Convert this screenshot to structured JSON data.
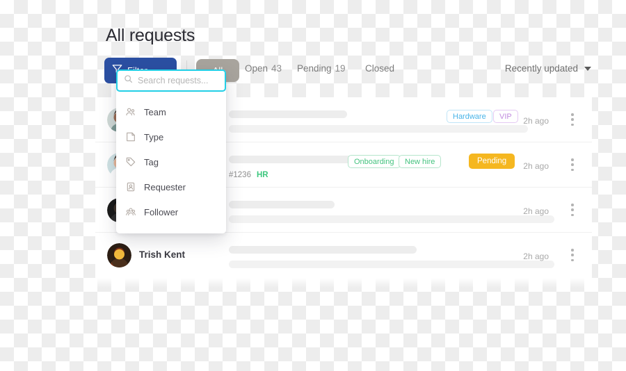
{
  "page": {
    "title": "All requests"
  },
  "toolbar": {
    "filter_button": {
      "label": "Filter",
      "icon": "filter-icon",
      "color": "#2b4fa2"
    },
    "all_pill": {
      "label": "All",
      "color": "#a8a49d"
    },
    "tabs": [
      {
        "label": "Open",
        "count": "43"
      },
      {
        "label": "Pending",
        "count": "19"
      },
      {
        "label": "Closed",
        "count": ""
      }
    ],
    "sort": {
      "label": "Recently updated",
      "icon": "chevron-down-icon"
    }
  },
  "search_popover": {
    "search": {
      "placeholder": "Search requests...",
      "value": "",
      "icon": "search-icon",
      "border_color": "#22cfe6"
    },
    "menu_items": [
      {
        "label": "Team",
        "icon": "team-icon"
      },
      {
        "label": "Type",
        "icon": "type-icon"
      },
      {
        "label": "Tag",
        "icon": "tag-icon"
      },
      {
        "label": "Requester",
        "icon": "requester-icon"
      },
      {
        "label": "Follower",
        "icon": "follower-icon"
      }
    ]
  },
  "requests": [
    {
      "requester": "",
      "ticket_id": "",
      "department": "",
      "chips": [
        {
          "label": "Hardware",
          "style": "chip-blue"
        },
        {
          "label": "VIP",
          "style": "chip-purple"
        }
      ],
      "status": "",
      "time": "2h ago",
      "menu_icon": "kebab-menu-icon",
      "skeleton": {
        "title_width": 170,
        "sub_width": 430
      }
    },
    {
      "requester": "",
      "ticket_id": "#1236",
      "department": "HR",
      "chips": [
        {
          "label": "Onboarding",
          "style": "chip-green"
        },
        {
          "label": "New hire",
          "style": "chip-green"
        }
      ],
      "status": "Pending",
      "time": "2h ago",
      "menu_icon": "kebab-menu-icon",
      "skeleton": {
        "title_width": 290,
        "sub_width": 0
      }
    },
    {
      "requester": "",
      "ticket_id": "",
      "department": "",
      "chips": [],
      "status": "",
      "time": "2h ago",
      "menu_icon": "kebab-menu-icon",
      "skeleton": {
        "title_width": 152,
        "sub_width": 468
      }
    },
    {
      "requester": "Trish Kent",
      "ticket_id": "",
      "department": "",
      "chips": [],
      "status": "",
      "time": "2h ago",
      "menu_icon": "kebab-menu-icon",
      "skeleton": {
        "title_width": 270,
        "sub_width": 468
      }
    }
  ],
  "colors": {
    "accent_cyan": "#22cfe6",
    "brand_blue": "#2b4fa2",
    "status_pending": "#f5b720",
    "tag_green": "#44c37f",
    "tag_blue": "#49b4e8",
    "tag_purple": "#c18bdf"
  }
}
